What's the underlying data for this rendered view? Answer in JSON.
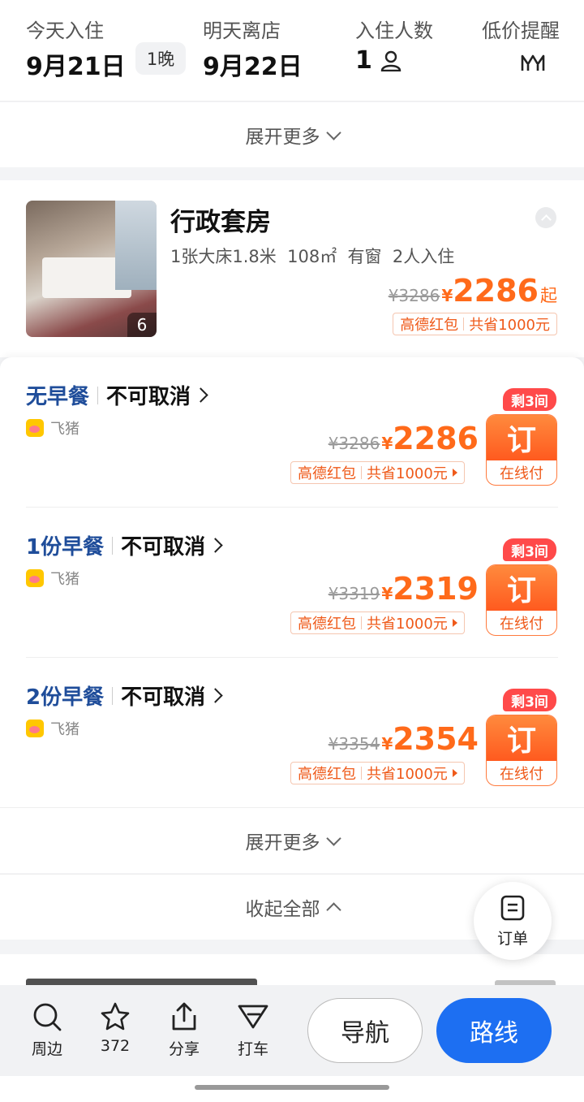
{
  "header": {
    "checkin_label": "今天入住",
    "checkin_date": "9月21日",
    "nights": "1晚",
    "checkout_label": "明天离店",
    "checkout_date": "9月22日",
    "guests_label": "入住人数",
    "guests_count": "1",
    "price_alert_label": "低价提醒"
  },
  "expand_more_top": "展开更多",
  "room": {
    "title": "行政套房",
    "photo_count": "6",
    "specs": "1张大床1.8米  108㎡  有窗  2人入住",
    "original_price": "¥3286",
    "currency": "¥",
    "price": "2286",
    "price_suffix": "起",
    "promo_a": "高德红包",
    "promo_b": "共省1000元"
  },
  "plans": [
    {
      "meal": "无早餐",
      "cancel": "不可取消",
      "source": "飞猪",
      "left": "剩3间",
      "original": "¥3286",
      "currency": "¥",
      "price": "2286",
      "promo_a": "高德红包",
      "promo_b": "共省1000元",
      "book": "订",
      "pay": "在线付"
    },
    {
      "meal": "1份早餐",
      "cancel": "不可取消",
      "source": "飞猪",
      "left": "剩3间",
      "original": "¥3319",
      "currency": "¥",
      "price": "2319",
      "promo_a": "高德红包",
      "promo_b": "共省1000元",
      "book": "订",
      "pay": "在线付"
    },
    {
      "meal": "2份早餐",
      "cancel": "不可取消",
      "source": "飞猪",
      "left": "剩3间",
      "original": "¥3354",
      "currency": "¥",
      "price": "2354",
      "promo_a": "高德红包",
      "promo_b": "共省1000元",
      "book": "订",
      "pay": "在线付"
    }
  ],
  "expand_more_plans": "展开更多",
  "collapse_all": "收起全部",
  "order_fab": "订单",
  "bottom_nav": {
    "nearby": "周边",
    "favorites": "372",
    "share": "分享",
    "taxi": "打车",
    "navigate": "导航",
    "route": "路线"
  },
  "colors": {
    "accent": "#1d6ff2",
    "price": "#ff6a1a",
    "meal": "#1f4d9a",
    "badge": "#ff4a4a"
  }
}
